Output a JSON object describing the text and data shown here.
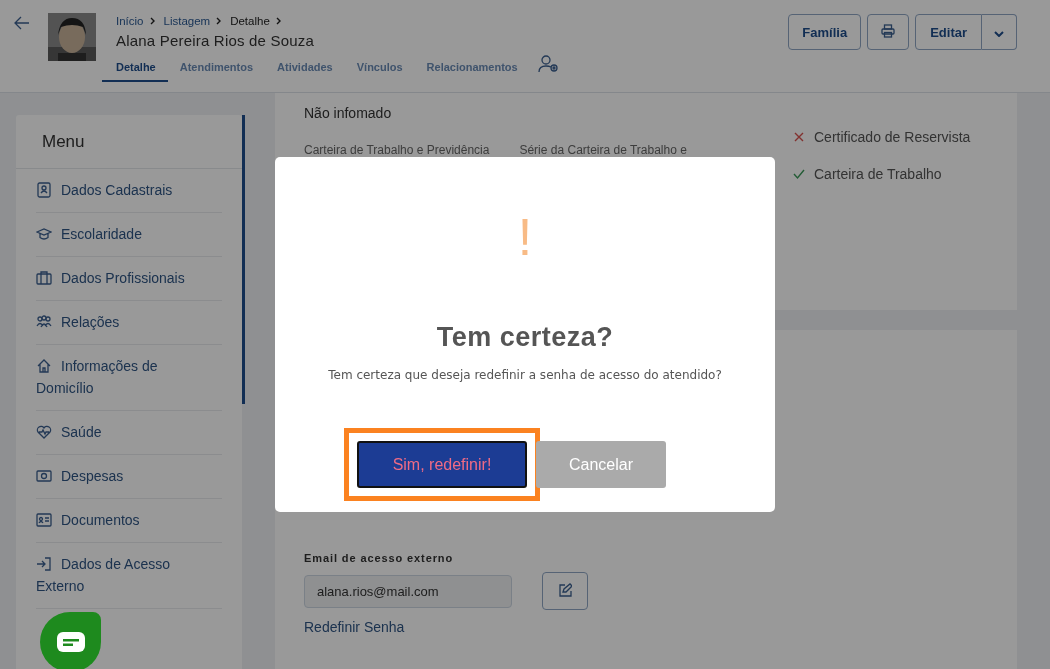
{
  "header": {
    "breadcrumb": [
      {
        "label": "Início",
        "link": true
      },
      {
        "label": "Listagem",
        "link": true
      },
      {
        "label": "Detalhe",
        "link": false
      }
    ],
    "person_name": "Alana Pereira Rios de Souza",
    "tabs": [
      {
        "label": "Detalhe",
        "selected": true
      },
      {
        "label": "Atendimentos",
        "selected": false
      },
      {
        "label": "Atividades",
        "selected": false
      },
      {
        "label": "Vínculos",
        "selected": false
      },
      {
        "label": "Relacionamentos",
        "selected": false
      }
    ],
    "buttons": [
      {
        "kind": "text",
        "label": "Família"
      },
      {
        "kind": "print"
      },
      {
        "kind": "split",
        "label": "Editar"
      }
    ]
  },
  "sidebar": {
    "title": "Menu",
    "items": [
      {
        "label": "Dados Cadastrais"
      },
      {
        "label": "Escolaridade"
      },
      {
        "label": "Dados Profissionais"
      },
      {
        "label": "Relações"
      },
      {
        "label": "Informações de Domicílio"
      },
      {
        "label": "Saúde"
      },
      {
        "label": "Despesas"
      },
      {
        "label": "Documentos"
      },
      {
        "label": "Dados de Acesso Externo"
      }
    ]
  },
  "details": {
    "value": "Não infomado",
    "labels": [
      "Carteira de Trabalho e Previdência",
      "Série da Carteira de Trabalho e"
    ],
    "documents": [
      {
        "label": "Certificado de Reservista",
        "checked": false
      },
      {
        "label": "Carteira de Trabalho",
        "checked": true
      }
    ]
  },
  "access": {
    "email_label": "Email de acesso externo",
    "email": "alana.rios@mail.com",
    "reset_link": "Redefinir Senha"
  },
  "modal": {
    "icon": "!",
    "title": "Tem certeza?",
    "message": "Tem certeza que deseja redefinir a senha de acesso do atendido?",
    "buttons": [
      {
        "kind": "confirm",
        "label": "Sim, redefinir!",
        "highlighted": true
      },
      {
        "kind": "cancel",
        "label": "Cancelar",
        "highlighted": false
      }
    ]
  }
}
